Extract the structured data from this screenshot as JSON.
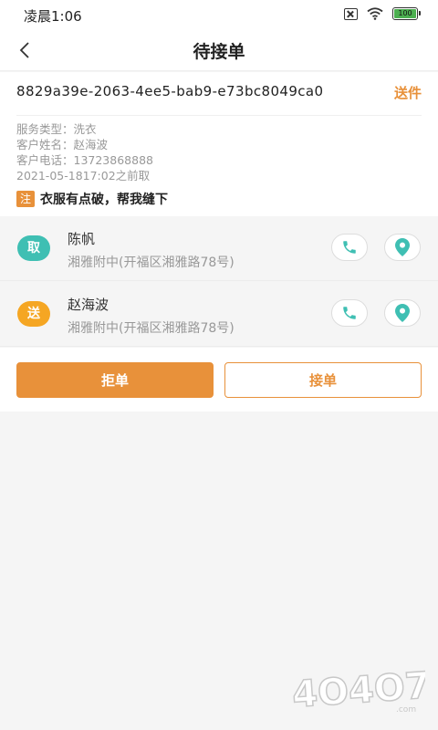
{
  "status_bar": {
    "time": "凌晨1:06",
    "battery": "100",
    "icons": [
      "sim-off-icon",
      "wifi-icon",
      "battery-icon"
    ]
  },
  "navbar": {
    "title": "待接单",
    "back_icon": "chevron-left-icon"
  },
  "order": {
    "id": "8829a39e-2063-4ee5-bab9-e73bc8049ca0",
    "type": "送件",
    "service_type": "服务类型：洗衣",
    "customer_name": "客户姓名：赵海波",
    "customer_phone": "客户电话：13723868888",
    "pickup_time": "2021-05-1817:02之前取",
    "note_badge": "注",
    "note": "衣服有点破，帮我缝下"
  },
  "contacts": [
    {
      "badge": "取",
      "name": "陈帆",
      "address": "湘雅附中(开福区湘雅路78号)"
    },
    {
      "badge": "送",
      "name": "赵海波",
      "address": "湘雅附中(开福区湘雅路78号)"
    }
  ],
  "actions": {
    "reject": "拒单",
    "accept": "接单"
  },
  "colors": {
    "accent": "#e8913a",
    "pickup_badge": "#3fbfb3",
    "send_badge": "#f5a623",
    "icon_teal": "#3fbfb3"
  },
  "watermark": "4O4O7.com"
}
